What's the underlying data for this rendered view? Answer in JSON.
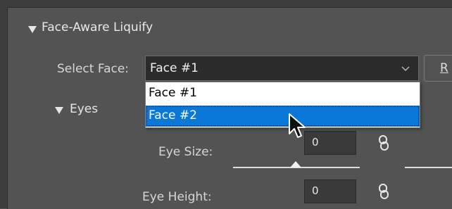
{
  "panel": {
    "section_title": "Face-Aware Liquify",
    "select_face_label": "Select Face:",
    "selected_face": "Face #1",
    "r_button_label": "R",
    "dropdown_options": [
      "Face #1",
      "Face #2"
    ],
    "highlighted_option_index": 1,
    "eyes_section_title": "Eyes",
    "eye_size_label": "Eye Size:",
    "eye_size_value": "0",
    "eye_height_label": "Eye Height:",
    "eye_height_value": "0"
  },
  "colors": {
    "background": "#535353",
    "select_background": "#2b2b2b",
    "highlight": "#0a78d7"
  },
  "icons": {
    "collapse": "triangle-down-icon",
    "chevron": "chevron-down-icon",
    "link": "chain-link-icon",
    "cursor": "arrow-cursor-icon"
  }
}
